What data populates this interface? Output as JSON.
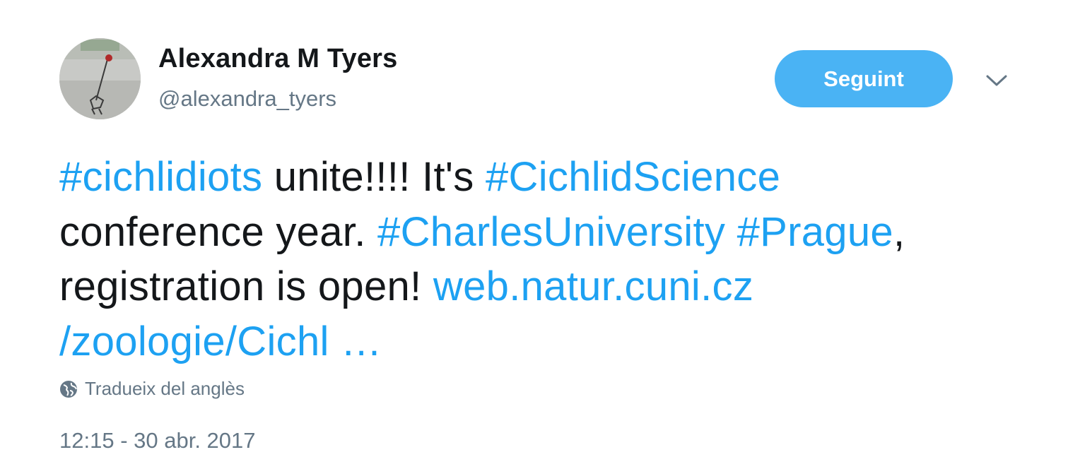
{
  "user": {
    "display_name": "Alexandra M Tyers",
    "handle": "@alexandra_tyers",
    "avatar_icon": "profile-photo"
  },
  "actions": {
    "follow_label": "Seguint",
    "more_icon": "chevron-down-icon"
  },
  "tweet": {
    "lines": [
      [
        {
          "type": "hashtag",
          "text": "#cichlidiots"
        },
        {
          "type": "text",
          "text": " unite!!!! It's "
        },
        {
          "type": "hashtag",
          "text": "#CichlidScience"
        }
      ],
      [
        {
          "type": "text",
          "text": "conference year. "
        },
        {
          "type": "hashtag",
          "text": "#CharlesUniversity"
        },
        {
          "type": "text",
          "text": " "
        },
        {
          "type": "hashtag",
          "text": "#Prague"
        },
        {
          "type": "text",
          "text": ","
        }
      ],
      [
        {
          "type": "text",
          "text": "registration is open! "
        },
        {
          "type": "link",
          "text": "web.natur.cuni.cz"
        }
      ],
      [
        {
          "type": "link",
          "text": "/zoologie/Cichl …"
        }
      ]
    ]
  },
  "translate": {
    "icon": "globe-icon",
    "label": "Tradueix del anglès"
  },
  "timestamp": "12:15 - 30 abr. 2017",
  "colors": {
    "link": "#1da1f2",
    "button": "#4ab3f4",
    "secondary_text": "#657786",
    "primary_text": "#14171a"
  }
}
